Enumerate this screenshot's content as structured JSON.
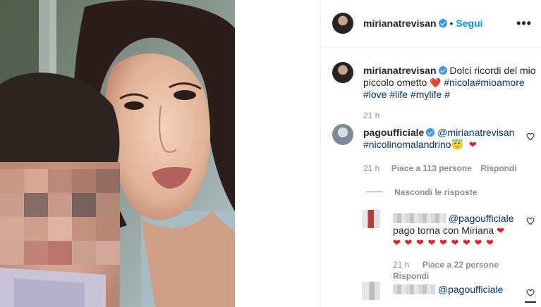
{
  "post": {
    "author": "mirianatrevisan",
    "follow_label": "Segui",
    "dot": "•",
    "more": "•••"
  },
  "caption": {
    "username": "mirianatrevisan",
    "text": "Dolci ricordi del mio piccolo ometto",
    "hashtags_line1": "#nicola#mioamore",
    "hashtags_line2": "#love #life #mylife #",
    "time": "21 h"
  },
  "comments": [
    {
      "username": "pagoufficiale",
      "mention": "@mirianatrevisan",
      "tag": "#nicolinomalandrino",
      "emoji": "😇",
      "heart": "❤",
      "time": "21 h",
      "likes": "Piace a 113 persone",
      "reply_label": "Rispondi",
      "hide_replies": "Nascondi le risposte"
    }
  ],
  "replies": [
    {
      "mention": "@pagoufficiale",
      "text": "pago torna con Miriana",
      "heart": "❤",
      "hearts_row": "❤ ❤ ❤ ❤ ❤ ❤ ❤ ❤ ❤",
      "time": "21 h",
      "likes": "Piace a 22 persone",
      "reply_label": "Rispondi"
    },
    {
      "mention": "@pagoufficiale"
    }
  ],
  "icons": {
    "verified": "verified-badge-icon",
    "more": "more-options-icon",
    "like": "heart-outline-icon"
  },
  "colors": {
    "link": "#0095f6",
    "hashtag": "#00376b",
    "muted": "#8e8e8e",
    "heart": "#ed1c24"
  }
}
